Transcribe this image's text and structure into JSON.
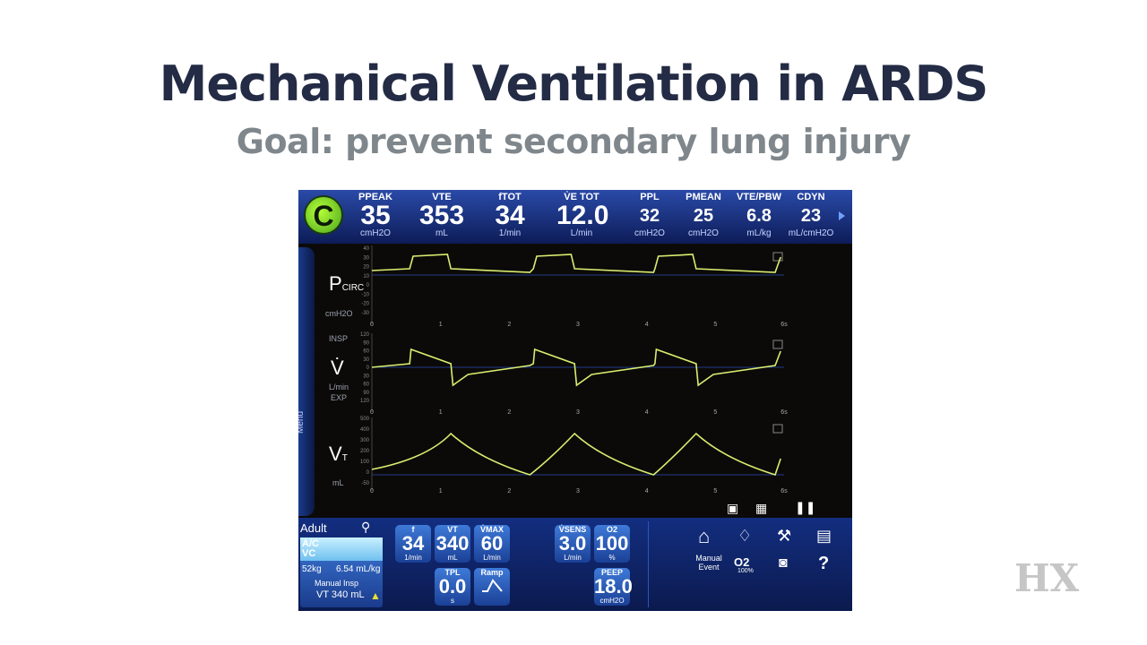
{
  "slide": {
    "title": "Mechanical Ventilation in ARDS",
    "subtitle": "Goal: prevent secondary lung injury"
  },
  "monitor": {
    "logo": "C",
    "params": [
      {
        "label": "PPEAK",
        "value": "35",
        "unit": "cmH2O"
      },
      {
        "label": "VTE",
        "value": "353",
        "unit": "mL"
      },
      {
        "label": "fTOT",
        "value": "34",
        "unit": "1/min"
      },
      {
        "label": "V̇E TOT",
        "value": "12.0",
        "unit": "L/min"
      },
      {
        "label": "PPL",
        "value": "32",
        "unit": "cmH2O"
      },
      {
        "label": "PMEAN",
        "value": "25",
        "unit": "cmH2O"
      },
      {
        "label": "VTE/PBW",
        "value": "6.8",
        "unit": "mL/kg"
      },
      {
        "label": "CDYN",
        "value": "23",
        "unit": "mL/cmH2O"
      }
    ],
    "menu_label": "Menu",
    "waveforms": {
      "pressure": {
        "label": "P",
        "sub": "CIRC",
        "unit": "cmH2O",
        "yticks": [
          "40",
          "30",
          "20",
          "10",
          "0",
          "-10",
          "-20",
          "-30"
        ]
      },
      "flow": {
        "label": "V̇",
        "unit": "L/min",
        "insp": "INSP",
        "exp": "EXP",
        "yticks": [
          "120",
          "90",
          "60",
          "30",
          "0",
          "30",
          "60",
          "90",
          "120"
        ]
      },
      "volume": {
        "label": "V",
        "sub": "T",
        "unit": "mL",
        "yticks": [
          "500",
          "400",
          "300",
          "200",
          "100",
          "0",
          "-50"
        ]
      },
      "xticks": [
        "0",
        "1",
        "2",
        "3",
        "4",
        "5",
        "6s"
      ]
    },
    "bottom": {
      "patient": "Adult",
      "mode_line1": "A/C",
      "mode_line2": "VC",
      "weight": "52kg",
      "ratio": "6.54 mL/kg",
      "manual_insp": "Manual Insp",
      "manual_vt": "VT 340 mL",
      "settings": [
        {
          "label": "f",
          "value": "34",
          "unit": "1/min"
        },
        {
          "label": "VT",
          "value": "340",
          "unit": "mL"
        },
        {
          "label": "V̇MAX",
          "value": "60",
          "unit": "L/min"
        },
        {
          "label": "V̇SENS",
          "value": "3.0",
          "unit": "L/min"
        },
        {
          "label": "O2",
          "value": "100",
          "unit": "%"
        },
        {
          "label": "TPL",
          "value": "0.0",
          "unit": "s"
        },
        {
          "label": "Ramp",
          "value": "",
          "unit": ""
        },
        {
          "label": "PEEP",
          "value": "18.0",
          "unit": "cmH2O"
        }
      ],
      "manual_event": "Manual Event",
      "o2_label": "O2",
      "o2_sub": "100%",
      "help": "?"
    }
  },
  "branding": {
    "logo_text": "HX"
  }
}
